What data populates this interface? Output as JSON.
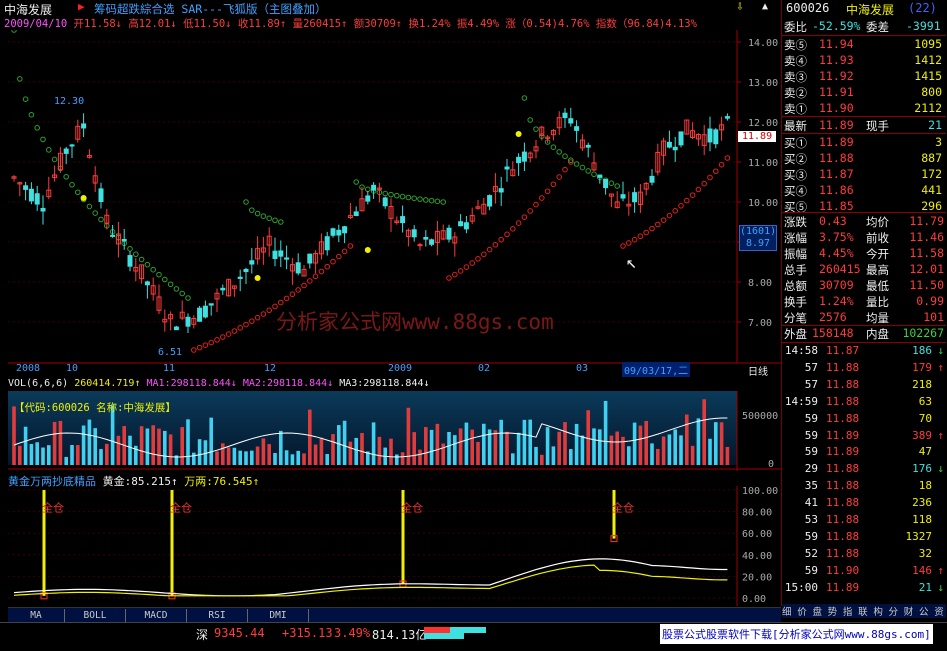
{
  "header": {
    "stock_name": "中海发展",
    "indicator_title": "筹码超跌綜合选 SAR---飞狐版（主图叠加）",
    "right_stock_code": "600026",
    "right_stock_name": "中海发展",
    "right_badge": "(22)"
  },
  "quote_line": {
    "date": "2009/04/10",
    "open": "开11.58↓",
    "high": "高12.01↓",
    "low": "低11.50↓",
    "close": "收11.89↑",
    "volume": "量260415↑",
    "amount": "额30709↑",
    "turnover": "换1.24%",
    "amplitude": "振4.49%",
    "change": "涨（0.54)4.76%",
    "index": "指数（96.84)4.13%"
  },
  "main_chart": {
    "price_axis": [
      "14.00",
      "13.00",
      "12.00",
      "11.00",
      "10.00",
      "9.00",
      "8.00",
      "7.00"
    ],
    "current_price_tag": "11.89",
    "cross_tag_top": "(1601)",
    "cross_tag_bottom": "8.97",
    "high_label": "12.30",
    "low_label": "6.51",
    "watermark": "分析家公式网www.88gs.com",
    "date_axis": [
      "2008",
      "10",
      "11",
      "12",
      "2009",
      "02",
      "03"
    ],
    "date_cursor": "09/03/17,二",
    "period": "日线"
  },
  "vol_panel": {
    "title": "VOL(6,6,6)",
    "vol": "260414.719↑",
    "ma1": "MA1:298118.844↓",
    "ma2": "MA2:298118.844↓",
    "ma3": "MA3:298118.844↓",
    "info": "【代码:600026 名称:中海发展】",
    "axis": [
      "500000",
      "0"
    ]
  },
  "ind_panel": {
    "title": "黄金万两抄底精品",
    "gold": "黄金:85.215↑",
    "wanliang": "万两:76.545↑",
    "buy_label": "全仓",
    "axis": [
      "100.00",
      "80.00",
      "60.00",
      "40.00",
      "20.00",
      "0.00"
    ]
  },
  "tabs": [
    "MA",
    "BOLL",
    "MACD",
    "RSI",
    "DMI"
  ],
  "order_book": {
    "weibi_label": "委比",
    "weibi_value": "-52.59%",
    "weicha_label": "委差",
    "weicha_value": "-3991",
    "sells": [
      {
        "label": "卖⑤",
        "price": "11.94",
        "vol": "1095"
      },
      {
        "label": "卖④",
        "price": "11.93",
        "vol": "1412"
      },
      {
        "label": "卖③",
        "price": "11.92",
        "vol": "1415"
      },
      {
        "label": "卖②",
        "price": "11.91",
        "vol": "800"
      },
      {
        "label": "卖①",
        "price": "11.90",
        "vol": "2112"
      }
    ],
    "last_label": "最新",
    "last_price": "11.89",
    "current_hand_label": "现手",
    "current_hand": "21",
    "buys": [
      {
        "label": "买①",
        "price": "11.89",
        "vol": "3"
      },
      {
        "label": "买②",
        "price": "11.88",
        "vol": "887"
      },
      {
        "label": "买③",
        "price": "11.87",
        "vol": "172"
      },
      {
        "label": "买④",
        "price": "11.86",
        "vol": "441"
      },
      {
        "label": "买⑤",
        "price": "11.85",
        "vol": "296"
      }
    ]
  },
  "stats": [
    {
      "l1": "涨跌",
      "v1": "0.43",
      "l2": "均价",
      "v2": "11.79"
    },
    {
      "l1": "涨幅",
      "v1": "3.75%",
      "l2": "前收",
      "v2": "11.46"
    },
    {
      "l1": "振幅",
      "v1": "4.45%",
      "l2": "今开",
      "v2": "11.58"
    },
    {
      "l1": "总手",
      "v1": "260415",
      "l2": "最高",
      "v2": "12.01"
    },
    {
      "l1": "总额",
      "v1": "30709",
      "l2": "最低",
      "v2": "11.50"
    },
    {
      "l1": "换手",
      "v1": "1.24%",
      "l2": "量比",
      "v2": "0.99"
    },
    {
      "l1": "分笔",
      "v1": "2576",
      "l2": "均量",
      "v2": "101"
    }
  ],
  "outer_inner": {
    "outer_label": "外盘",
    "outer": "158148",
    "inner_label": "内盘",
    "inner": "102267"
  },
  "ticks": [
    {
      "time": "14:58",
      "price": "11.87",
      "vol": "186",
      "arrow": "↓"
    },
    {
      "time": "57",
      "price": "11.88",
      "vol": "179",
      "arrow": "↑"
    },
    {
      "time": "57",
      "price": "11.88",
      "vol": "218",
      "arrow": ""
    },
    {
      "time": "14:59",
      "price": "11.88",
      "vol": "63",
      "arrow": ""
    },
    {
      "time": "59",
      "price": "11.88",
      "vol": "70",
      "arrow": ""
    },
    {
      "time": "59",
      "price": "11.89",
      "vol": "389",
      "arrow": "↑"
    },
    {
      "time": "59",
      "price": "11.89",
      "vol": "47",
      "arrow": ""
    },
    {
      "time": "29",
      "price": "11.88",
      "vol": "176",
      "arrow": "↓"
    },
    {
      "time": "35",
      "price": "11.88",
      "vol": "18",
      "arrow": ""
    },
    {
      "time": "41",
      "price": "11.88",
      "vol": "236",
      "arrow": ""
    },
    {
      "time": "53",
      "price": "11.88",
      "vol": "118",
      "arrow": ""
    },
    {
      "time": "59",
      "price": "11.88",
      "vol": "1327",
      "arrow": ""
    },
    {
      "time": "52",
      "price": "11.88",
      "vol": "32",
      "arrow": ""
    },
    {
      "time": "59",
      "price": "11.90",
      "vol": "146",
      "arrow": "↑"
    },
    {
      "time": "15:00",
      "price": "11.89",
      "vol": "21",
      "arrow": "↓"
    }
  ],
  "right_footer_tabs": "细 价 盘 势 指 联 构 分 财 公 资 值",
  "status": {
    "index_name": "深",
    "index_value": "9345.44",
    "index_change": "+315.13",
    "index_pct": "3.49%",
    "index_amount": "814.13亿",
    "ad_text": "股票公式股票软件下载[分析家公式网www.88gs.com]"
  },
  "colors": {
    "up": "#ff3c3c",
    "down": "#40e0e0",
    "sar_up": "#e02020",
    "sar_down": "#2ca02c",
    "gold_line": "#ffffff",
    "wanliang_line": "#f0f000"
  }
}
